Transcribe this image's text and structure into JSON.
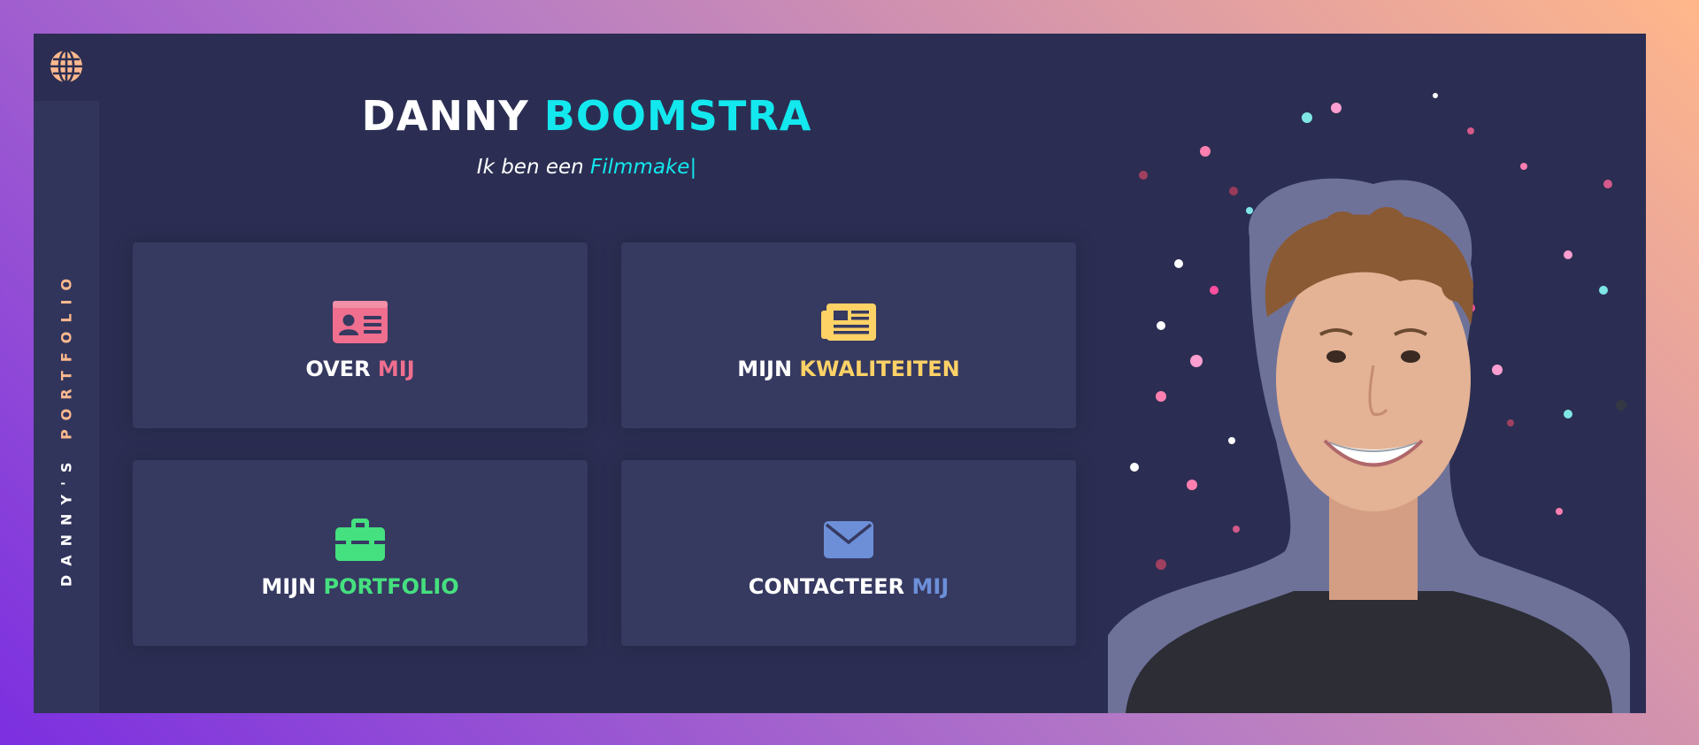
{
  "sidebar": {
    "vertical_text_main": "DANNY'S ",
    "vertical_text_highlight": "PORTFOLIO",
    "language_icon": "globe-icon"
  },
  "header": {
    "name_first": "DANNY",
    "name_last": "BOOMSTRA",
    "tagline_prefix": "Ik ben een",
    "tagline_typed": "Filmmake",
    "tagline_cursor": "|"
  },
  "cards": [
    {
      "icon": "id-card-icon",
      "label_main": "OVER ",
      "label_highlight": "MIJ",
      "accent": "#f06e8e"
    },
    {
      "icon": "newspaper-icon",
      "label_main": "MIJN ",
      "label_highlight": "KWALITEITEN",
      "accent": "#ffd266"
    },
    {
      "icon": "toolbox-icon",
      "label_main": "MIJN ",
      "label_highlight": "PORTFOLIO",
      "accent": "#45e07f"
    },
    {
      "icon": "envelope-icon",
      "label_main": "CONTACTEER ",
      "label_highlight": "MIJ",
      "accent": "#6c8fd8"
    }
  ],
  "colors": {
    "background_panel": "#2b2e52",
    "card": "#363960",
    "name_highlight": "#13e8ee",
    "sidebar_highlight": "#ffb98e",
    "globe": "#ffb98e"
  },
  "photo": {
    "subject": "portrait-photo"
  }
}
